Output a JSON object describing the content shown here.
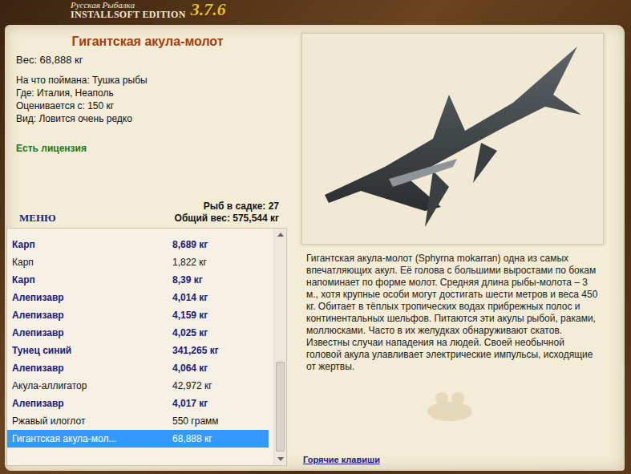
{
  "logo": {
    "line1": "Русская Рыбалка",
    "line2": "INSTALLSOFT EDITION",
    "version": "3.7.6"
  },
  "fish": {
    "title": "Гигантская акула-молот",
    "weight": "Вес: 68,888 кг",
    "details": [
      "На что поймана: Тушка рыбы",
      "Где: Италия, Неаполь",
      "Оценивается с: 150 кг",
      "Вид: Ловится очень редко"
    ],
    "license": "Есть лицензия"
  },
  "menu": "МЕНЮ",
  "keepnet": {
    "count": "Рыб в садке: 27",
    "total": "Общий вес: 575,544 кг"
  },
  "catch_list": [
    {
      "name": "Карп",
      "weight": "8,689 кг",
      "trophy": true,
      "selected": false
    },
    {
      "name": "Карп",
      "weight": "1,822 кг",
      "trophy": false,
      "selected": false
    },
    {
      "name": "Карп",
      "weight": "8,39 кг",
      "trophy": true,
      "selected": false
    },
    {
      "name": "Алепизавр",
      "weight": "4,014 кг",
      "trophy": true,
      "selected": false
    },
    {
      "name": "Алепизавр",
      "weight": "4,159 кг",
      "trophy": true,
      "selected": false
    },
    {
      "name": "Алепизавр",
      "weight": "4,025 кг",
      "trophy": true,
      "selected": false
    },
    {
      "name": "Тунец синий",
      "weight": "341,265 кг",
      "trophy": true,
      "selected": false
    },
    {
      "name": "Алепизавр",
      "weight": "4,064 кг",
      "trophy": true,
      "selected": false
    },
    {
      "name": "Акула-аллигатор",
      "weight": "42,972 кг",
      "trophy": false,
      "selected": false
    },
    {
      "name": "Алепизавр",
      "weight": "4,017 кг",
      "trophy": true,
      "selected": false
    },
    {
      "name": "Ржавый илоглот",
      "weight": "550 грамм",
      "trophy": false,
      "selected": false
    },
    {
      "name": "Гигантская акула-мол...",
      "weight": "68,888 кг",
      "trophy": false,
      "selected": true
    }
  ],
  "description": "Гигантская акула-молот (Sphyrna mokarran) одна из самых впечатляющих акул. Её голова с большими выростами по бокам напоминает по форме молот. Средняя длина рыбы-молота – 3 м., хотя крупные особи могут достигать шести метров и веса 450 кг. Обитает в тёплых тропических водах прибрежных полос и континентальных шельфов. Питаются эти акулы рыбой, раками, моллюсками. Часто в их желудках обнаруживают скатов. Известны случаи нападения на людей. Своей необычной головой акула улавливает электрические импульсы, исходящие от жертвы.",
  "hotkeys": "Горячие клавиши"
}
